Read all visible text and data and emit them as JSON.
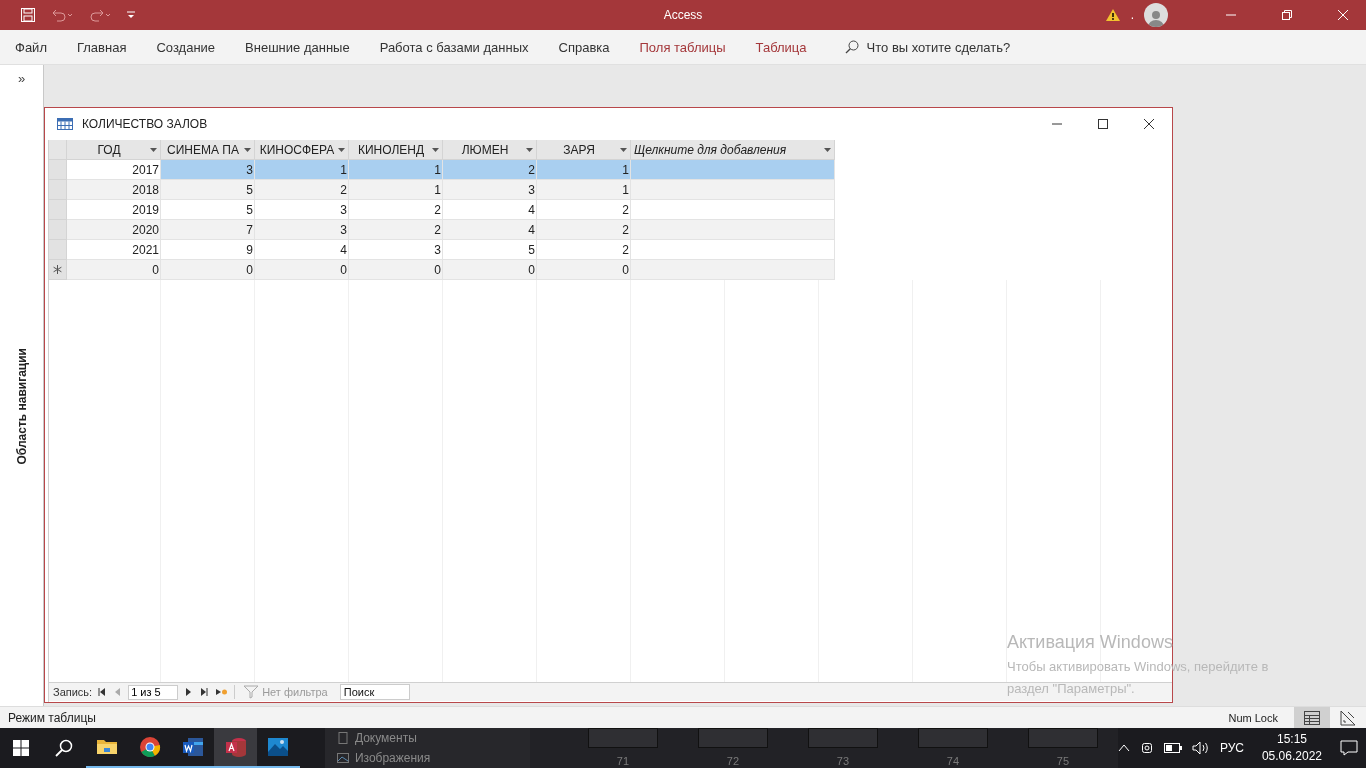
{
  "window": {
    "title": "Access",
    "account_name": "."
  },
  "ribbon_tabs": [
    {
      "label": "Файл",
      "kind": "main"
    },
    {
      "label": "Главная",
      "kind": "main"
    },
    {
      "label": "Создание",
      "kind": "main"
    },
    {
      "label": "Внешние данные",
      "kind": "main"
    },
    {
      "label": "Работа с базами данных",
      "kind": "main"
    },
    {
      "label": "Справка",
      "kind": "main"
    },
    {
      "label": "Поля таблицы",
      "kind": "context"
    },
    {
      "label": "Таблица",
      "kind": "context"
    }
  ],
  "tell_me": {
    "placeholder": "Что вы хотите сделать?"
  },
  "nav_pane": {
    "toggle": "»",
    "title": "Область навигации"
  },
  "document": {
    "title": "КОЛИЧЕСТВО ЗАЛОВ",
    "columns": [
      {
        "label": "ГОД",
        "kind": "field"
      },
      {
        "label": "СИНЕМА ПА",
        "kind": "field"
      },
      {
        "label": "КИНОСФЕРА",
        "kind": "field"
      },
      {
        "label": "КИНОЛЕНД",
        "kind": "field"
      },
      {
        "label": "ЛЮМЕН",
        "kind": "field"
      },
      {
        "label": "ЗАРЯ",
        "kind": "field"
      },
      {
        "label": "Щелкните для добавления",
        "kind": "add"
      }
    ],
    "rows": [
      {
        "kind": "record",
        "selected": true,
        "cells": [
          "2017",
          "3",
          "1",
          "1",
          "2",
          "1"
        ]
      },
      {
        "kind": "record",
        "selected": false,
        "cells": [
          "2018",
          "5",
          "2",
          "1",
          "3",
          "1"
        ]
      },
      {
        "kind": "record",
        "selected": false,
        "cells": [
          "2019",
          "5",
          "3",
          "2",
          "4",
          "2"
        ]
      },
      {
        "kind": "record",
        "selected": false,
        "cells": [
          "2020",
          "7",
          "3",
          "2",
          "4",
          "2"
        ]
      },
      {
        "kind": "record",
        "selected": false,
        "cells": [
          "2021",
          "9",
          "4",
          "3",
          "5",
          "2"
        ]
      },
      {
        "kind": "new",
        "selected": false,
        "cells": [
          "0",
          "0",
          "0",
          "0",
          "0",
          "0"
        ]
      }
    ],
    "record_nav": {
      "label": "Запись:",
      "position": "1 из 5",
      "filter": {
        "label": "Нет фильтра",
        "disabled": true
      },
      "search": {
        "placeholder": "Поиск"
      }
    }
  },
  "status_bar": {
    "mode": "Режим таблицы",
    "num_lock": "Num Lock",
    "view_buttons": [
      {
        "selected": true
      },
      {
        "selected": false
      }
    ]
  },
  "taskbar": {
    "apps": [
      {
        "kind": "folder",
        "active": false
      },
      {
        "kind": "chrome",
        "active": false
      },
      {
        "kind": "word",
        "active": false
      },
      {
        "kind": "access",
        "active": true
      },
      {
        "kind": "photos",
        "active": false
      }
    ],
    "backdrop": {
      "folders": [
        "Документы",
        "Изображения"
      ],
      "thumbnails": [
        "71",
        "72",
        "73",
        "74",
        "75"
      ]
    },
    "language": "РУС",
    "time": "15:15",
    "date": "05.06.2022"
  },
  "watermark": {
    "title": "Активация Windows",
    "lines": [
      "Чтобы активировать Windows, перейдите в",
      "раздел \"Параметры\"."
    ]
  }
}
